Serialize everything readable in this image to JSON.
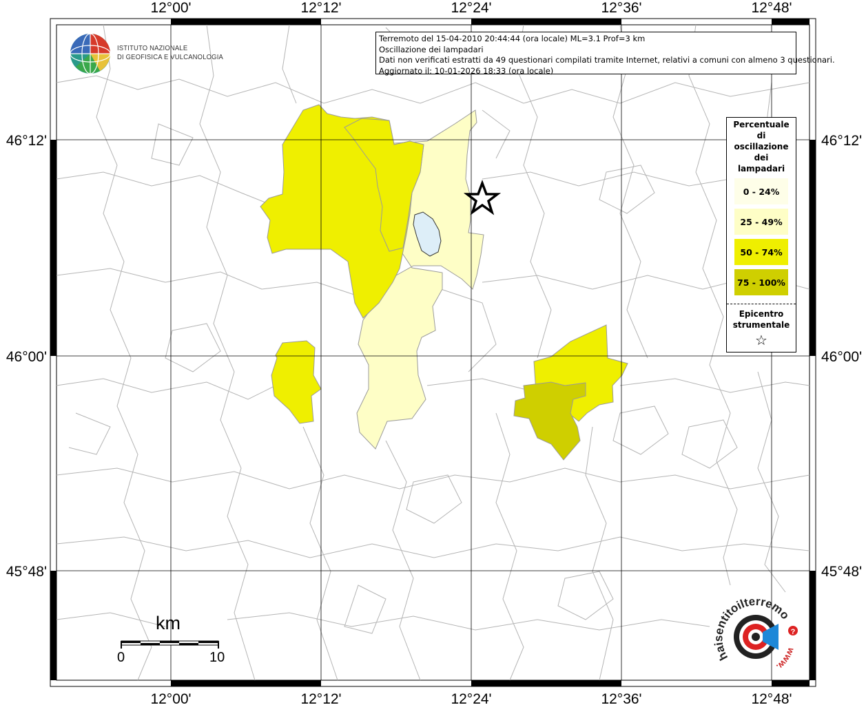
{
  "header": {
    "line1": "Terremoto del 15-04-2010 20:44:44 (ora locale) ML=3.1 Prof=3 km",
    "line2": "Oscillazione dei lampadari",
    "line3": "Dati non verificati estratti da 49 questionari compilati tramite Internet, relativi a comuni con almeno 3 questionari.",
    "line4": "Aggiornato il: 10-01-2026 18:33 (ora locale)"
  },
  "ingv_logo": {
    "line1": "ISTITUTO NAZIONALE",
    "line2": "DI GEOFISICA E VULCANOLOGIA"
  },
  "axes": {
    "lon_labels": [
      "12°00'",
      "12°12'",
      "12°24'",
      "12°36'",
      "12°48'"
    ],
    "lat_labels": [
      "46°12'",
      "46°00'",
      "45°48'"
    ]
  },
  "legend": {
    "title_lines": [
      "Percentuale",
      "di",
      "oscillazione",
      "dei",
      "lampadari"
    ],
    "classes": [
      {
        "label": "0 - 24%",
        "color": "#fefee8"
      },
      {
        "label": "25 - 49%",
        "color": "#fefec6"
      },
      {
        "label": "50 - 74%",
        "color": "#efef00"
      },
      {
        "label": "75 - 100%",
        "color": "#cfcf00"
      }
    ],
    "epicenter_lines": [
      "Epicentro",
      "strumentale"
    ],
    "epicenter_symbol": "☆"
  },
  "scalebar": {
    "unit": "km",
    "start": "0",
    "end": "10"
  },
  "footer_logo": {
    "text": "haisentitoilterremoto.it",
    "url_text": "www.",
    "question": "?"
  },
  "colors": {
    "class_25_49": "#fefec6",
    "class_50_74": "#efef00",
    "class_75_100": "#cfcf00",
    "lake": "#ddeef8",
    "boundary": "#aaaaaa"
  }
}
